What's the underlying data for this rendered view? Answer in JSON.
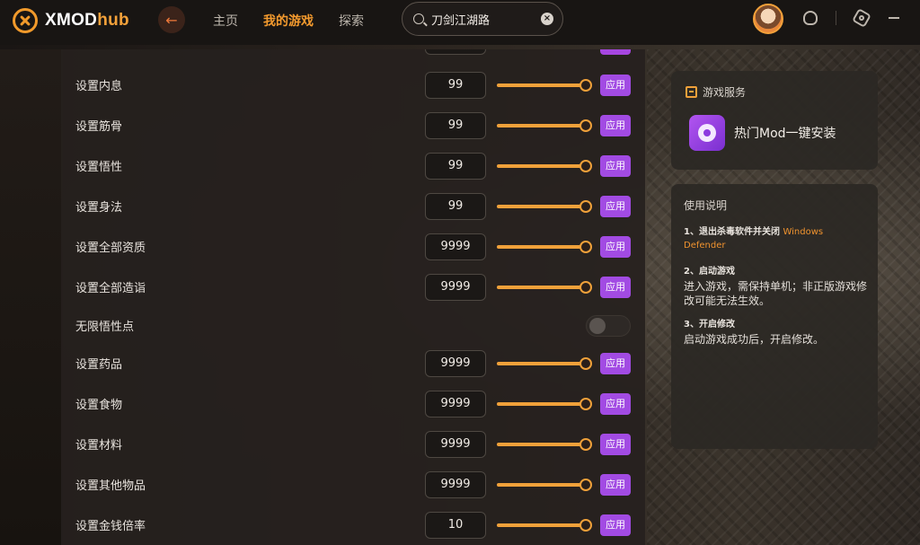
{
  "app": {
    "logo_main": "XMOD",
    "logo_sub": "hub",
    "nav": [
      "主页",
      "我的游戏",
      "探索"
    ],
    "search_value": "刀剑江湖路"
  },
  "rows": [
    {
      "label": "设置内息",
      "value": "99",
      "apply": "应用"
    },
    {
      "label": "设置筋骨",
      "value": "99",
      "apply": "应用"
    },
    {
      "label": "设置悟性",
      "value": "99",
      "apply": "应用"
    },
    {
      "label": "设置身法",
      "value": "99",
      "apply": "应用"
    },
    {
      "label": "设置全部资质",
      "value": "9999",
      "apply": "应用"
    },
    {
      "label": "设置全部造诣",
      "value": "9999",
      "apply": "应用"
    },
    {
      "label": "无限悟性点",
      "toggle": false
    },
    {
      "label": "设置药品",
      "value": "9999",
      "apply": "应用"
    },
    {
      "label": "设置食物",
      "value": "9999",
      "apply": "应用"
    },
    {
      "label": "设置材料",
      "value": "9999",
      "apply": "应用"
    },
    {
      "label": "设置其他物品",
      "value": "9999",
      "apply": "应用"
    },
    {
      "label": "设置金钱倍率",
      "value": "10",
      "apply": "应用"
    }
  ],
  "service": {
    "title": "游戏服务",
    "mod_label": "热门Mod一键安装"
  },
  "guide": {
    "title": "使用说明",
    "step1_head": "1、退出杀毒软件并关闭",
    "step1_hl1": "Windows",
    "step1_hl2": "Defender",
    "step2_head": "2、启动游戏",
    "step2_body": "进入游戏，需保持单机；非正版游戏修改可能无法生效。",
    "step3_head": "3、开启修改",
    "step3_body": "启动游戏成功后，开启修改。"
  },
  "colors": {
    "accent": "#f39a2e",
    "apply": "#a24be3"
  }
}
